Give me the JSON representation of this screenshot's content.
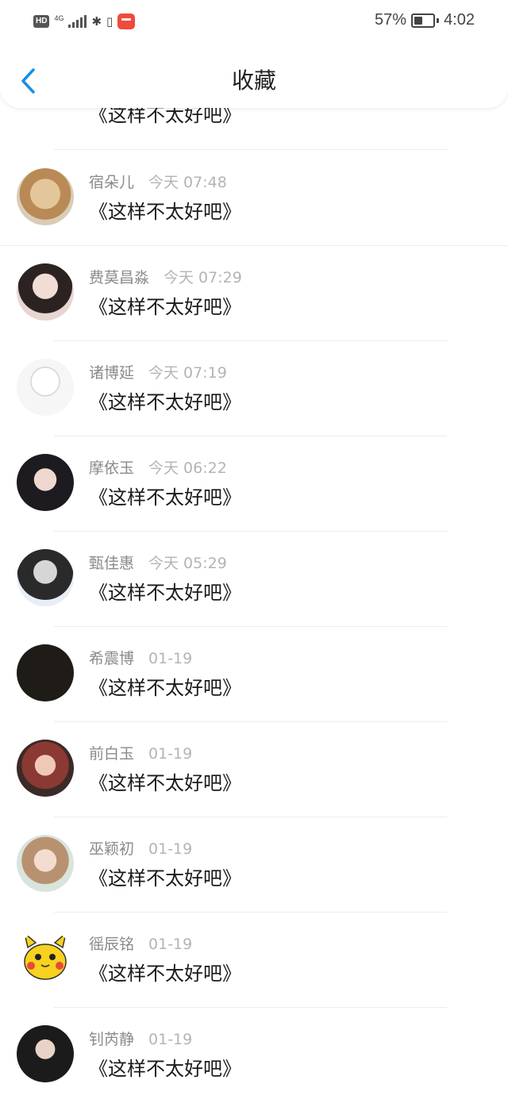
{
  "status_bar": {
    "hd": "HD",
    "network": "4G",
    "battery_percent": "57%",
    "battery_level": 0.57,
    "time": "4:02"
  },
  "header": {
    "title": "收藏",
    "back_icon": "chevron-left-icon"
  },
  "colors": {
    "accent": "#1a8fe3",
    "text": "#1a1a1a",
    "meta": "#9a9a9a"
  },
  "favorites": [
    {
      "name": "",
      "time": "",
      "text": "《这样不太好吧》"
    },
    {
      "name": "宿朵儿",
      "time": "今天 07:48",
      "text": "《这样不太好吧》"
    },
    {
      "name": "费莫昌淼",
      "time": "今天 07:29",
      "text": "《这样不太好吧》"
    },
    {
      "name": "诸博延",
      "time": "今天 07:19",
      "text": "《这样不太好吧》"
    },
    {
      "name": "摩依玉",
      "time": "今天 06:22",
      "text": "《这样不太好吧》"
    },
    {
      "name": "甄佳惠",
      "time": "今天 05:29",
      "text": "《这样不太好吧》"
    },
    {
      "name": "希震博",
      "time": "01-19",
      "text": "《这样不太好吧》"
    },
    {
      "name": "前白玉",
      "time": "01-19",
      "text": "《这样不太好吧》"
    },
    {
      "name": "巫颖初",
      "time": "01-19",
      "text": "《这样不太好吧》"
    },
    {
      "name": "徭辰铭",
      "time": "01-19",
      "text": "《这样不太好吧》"
    },
    {
      "name": "钊芮静",
      "time": "01-19",
      "text": "《这样不太好吧》"
    }
  ]
}
